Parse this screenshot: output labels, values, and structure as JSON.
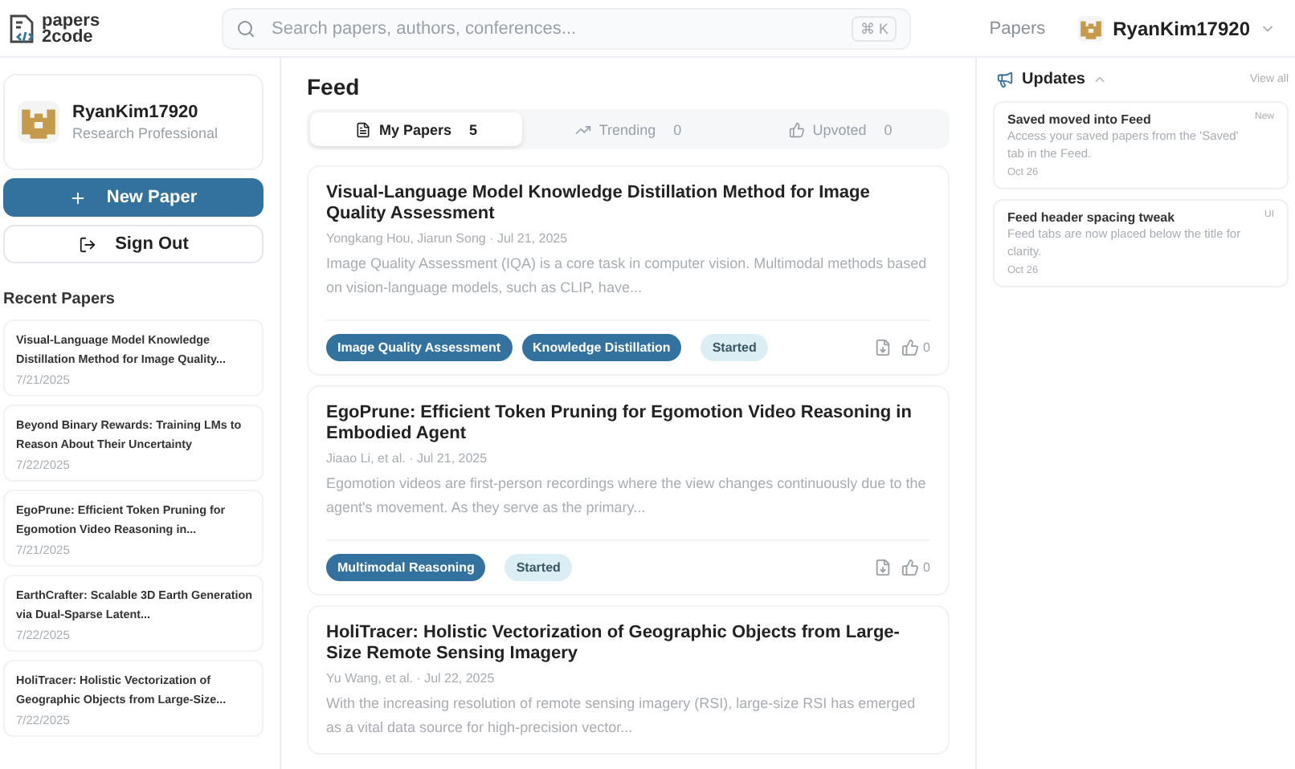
{
  "header": {
    "logo_top": "papers",
    "logo_bottom": "2code",
    "search": {
      "placeholder": "Search papers, authors, conferences...",
      "shortcut": "⌘ K"
    },
    "nav_link": "Papers",
    "user": "RyanKim17920"
  },
  "sidebar": {
    "profile": {
      "name": "RyanKim17920",
      "role": "Research Professional"
    },
    "buttons": [
      {
        "label": "New Paper",
        "kind": "primary"
      },
      {
        "label": "Sign Out",
        "kind": "secondary"
      }
    ],
    "recent_title": "Recent Papers",
    "recent": [
      {
        "title": "Visual-Language Model Knowledge Distillation Method for Image Quality...",
        "date": "7/21/2025"
      },
      {
        "title": "Beyond Binary Rewards: Training LMs to Reason About Their Uncertainty",
        "date": "7/22/2025"
      },
      {
        "title": "EgoPrune: Efficient Token Pruning for Egomotion Video Reasoning in...",
        "date": "7/21/2025"
      },
      {
        "title": "EarthCrafter: Scalable 3D Earth Generation via Dual-Sparse Latent...",
        "date": "7/22/2025"
      },
      {
        "title": "HoliTracer: Holistic Vectorization of Geographic Objects from Large-Size...",
        "date": "7/22/2025"
      }
    ]
  },
  "feed": {
    "title": "Feed",
    "tabs": [
      {
        "label": "My Papers",
        "count": "5",
        "kind": "file",
        "selected": true
      },
      {
        "label": "Trending",
        "count": "0",
        "kind": "trend",
        "selected": false
      },
      {
        "label": "Upvoted",
        "count": "0",
        "kind": "thumb",
        "selected": false
      }
    ],
    "papers": [
      {
        "title": "Visual-Language Model Knowledge Distillation Method for Image Quality Assessment",
        "meta": "Yongkang Hou, Jiarun Song · Jul 21, 2025",
        "abstract": "Image Quality Assessment (IQA) is a core task in computer vision. Multimodal methods based on vision-language models, such as CLIP, have...",
        "tags": [
          {
            "label": "Image Quality Assessment",
            "kind": "topic"
          },
          {
            "label": "Knowledge Distillation",
            "kind": "topic"
          },
          {
            "label": "Started",
            "kind": "status"
          }
        ],
        "votes": "0"
      },
      {
        "title": "EgoPrune: Efficient Token Pruning for Egomotion Video Reasoning in Embodied Agent",
        "meta": "Jiaao Li, et al. · Jul 21, 2025",
        "abstract": "Egomotion videos are first-person recordings where the view changes continuously due to the agent's movement. As they serve as the primary...",
        "tags": [
          {
            "label": "Multimodal Reasoning",
            "kind": "topic"
          },
          {
            "label": "Started",
            "kind": "status"
          }
        ],
        "votes": "0"
      },
      {
        "title": "HoliTracer: Holistic Vectorization of Geographic Objects from Large-Size Remote Sensing Imagery",
        "meta": "Yu Wang, et al. · Jul 22, 2025",
        "abstract": "With the increasing resolution of remote sensing imagery (RSI), large-size RSI has emerged as a vital data source for high-precision vector..."
      }
    ]
  },
  "updates": {
    "title": "Updates",
    "view_all": "View all",
    "items": [
      {
        "title": "Saved moved into Feed",
        "badge": "New",
        "body": "Access your saved papers from the 'Saved' tab in the Feed.",
        "date": "Oct 26"
      },
      {
        "title": "Feed header spacing tweak",
        "badge": "UI",
        "body": "Feed tabs are now placed below the title for clarity.",
        "date": "Oct 26"
      }
    ]
  }
}
